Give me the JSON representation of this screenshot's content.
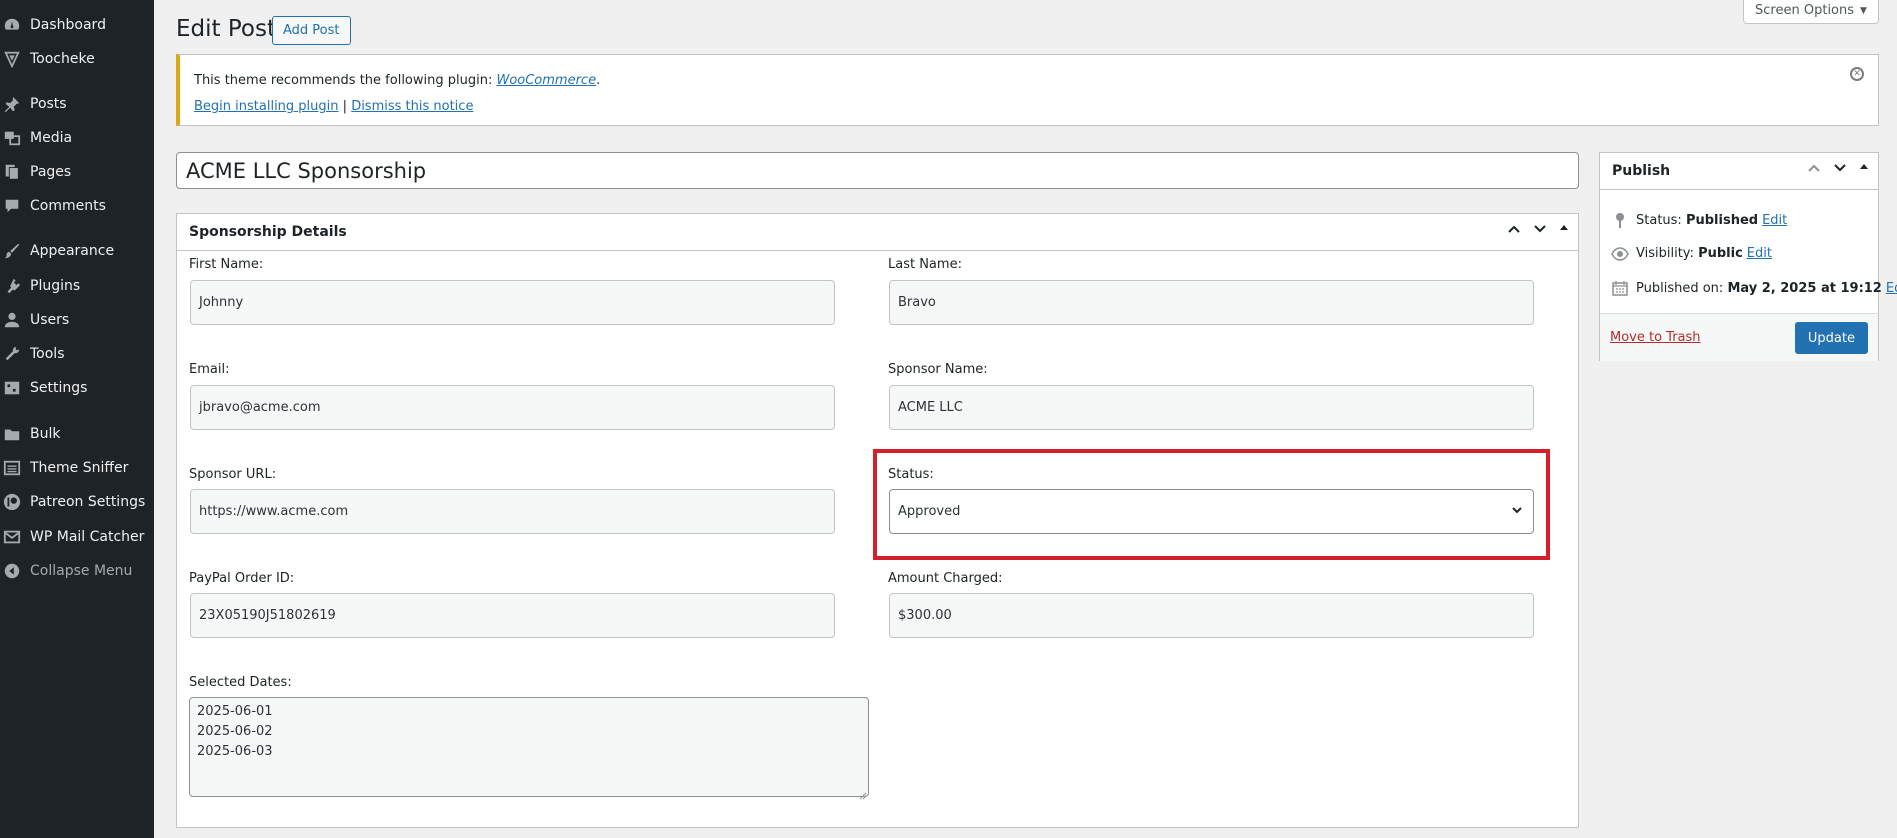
{
  "sidebar": {
    "items": [
      {
        "label": "Dashboard",
        "icon": "dashboard-icon"
      },
      {
        "label": "Toocheke",
        "icon": "toocheke-icon"
      },
      {
        "label": "Posts",
        "icon": "pin-icon"
      },
      {
        "label": "Media",
        "icon": "media-icon"
      },
      {
        "label": "Pages",
        "icon": "pages-icon"
      },
      {
        "label": "Comments",
        "icon": "comments-icon"
      },
      {
        "label": "Appearance",
        "icon": "paintbrush-icon"
      },
      {
        "label": "Plugins",
        "icon": "plugin-icon"
      },
      {
        "label": "Users",
        "icon": "users-icon"
      },
      {
        "label": "Tools",
        "icon": "wrench-icon"
      },
      {
        "label": "Settings",
        "icon": "settings-icon"
      },
      {
        "label": "Bulk",
        "icon": "folder-icon"
      },
      {
        "label": "Theme Sniffer",
        "icon": "list-icon"
      },
      {
        "label": "Patreon Settings",
        "icon": "patreon-icon"
      },
      {
        "label": "WP Mail Catcher",
        "icon": "mail-icon"
      },
      {
        "label": "Collapse Menu",
        "icon": "collapse-icon"
      }
    ]
  },
  "header": {
    "title": "Edit Post",
    "add_post": "Add Post",
    "screen_options": "Screen Options"
  },
  "notice": {
    "text_before": "This theme recommends the following plugin: ",
    "plugin": "WooCommerce",
    "text_after": ".",
    "install_link": "Begin installing plugin",
    "separator": "|",
    "dismiss_link": "Dismiss this notice"
  },
  "post": {
    "title": "ACME LLC Sponsorship"
  },
  "metabox": {
    "title": "Sponsorship Details",
    "fields": {
      "first_name": {
        "label": "First Name:",
        "value": "Johnny"
      },
      "last_name": {
        "label": "Last Name:",
        "value": "Bravo"
      },
      "email": {
        "label": "Email:",
        "value": "jbravo@acme.com"
      },
      "sponsor_name": {
        "label": "Sponsor Name:",
        "value": "ACME LLC"
      },
      "sponsor_url": {
        "label": "Sponsor URL:",
        "value": "https://www.acme.com"
      },
      "status": {
        "label": "Status:",
        "value": "Approved"
      },
      "paypal_order_id": {
        "label": "PayPal Order ID:",
        "value": "23X05190J51802619"
      },
      "amount_charged": {
        "label": "Amount Charged:",
        "value": "$300.00"
      },
      "selected_dates": {
        "label": "Selected Dates:",
        "lines": [
          "2025-06-01",
          "2025-06-02",
          "2025-06-03"
        ]
      }
    }
  },
  "publish": {
    "title": "Publish",
    "status_label": "Status:",
    "status_value": "Published",
    "visibility_label": "Visibility:",
    "visibility_value": "Public",
    "published_label": "Published on:",
    "published_value": "May 2, 2025 at 19:12",
    "edit": "Edit",
    "trash": "Move to Trash",
    "update": "Update"
  },
  "colors": {
    "sidebar_bg": "#1d2327",
    "accent": "#2271b1",
    "highlight": "#d3202b",
    "notice_border": "#dba617"
  }
}
